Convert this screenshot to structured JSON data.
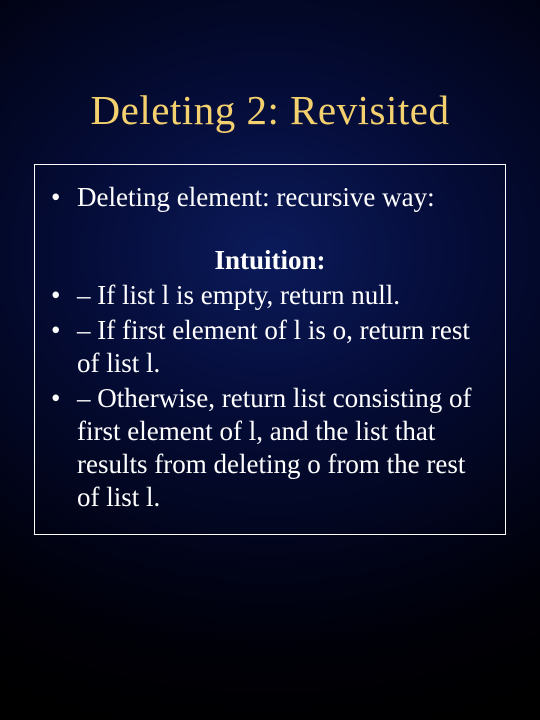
{
  "slide": {
    "title": "Deleting 2: Revisited",
    "top_bullet": {
      "marker": "•",
      "text": "Deleting element: recursive way:"
    },
    "intuition_label": "Intuition:",
    "bullets": [
      {
        "marker": "•",
        "text": "– If list l is empty, return null."
      },
      {
        "marker": "•",
        "text": "– If first element of l is o, return rest of list l."
      },
      {
        "marker": "•",
        "text": "– Otherwise, return list consisting of first element of l, and the list that results from deleting o from the rest of list l."
      }
    ]
  }
}
